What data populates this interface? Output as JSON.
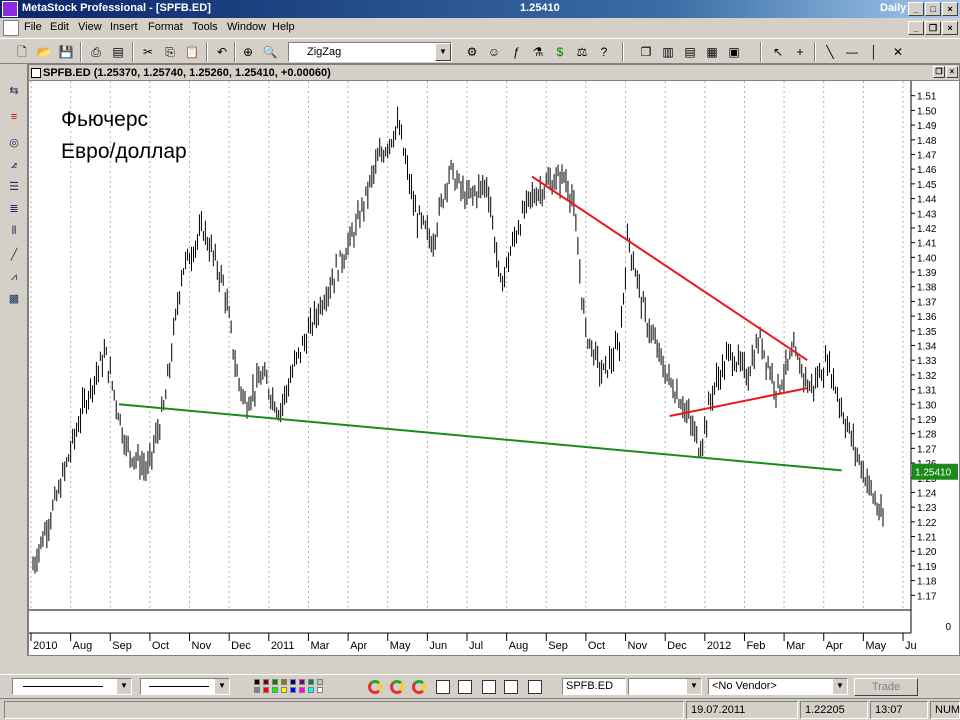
{
  "window": {
    "title": "MetaStock Professional - [SPFB.ED]",
    "price": "1.25410",
    "period": "Daily"
  },
  "menu": [
    "File",
    "Edit",
    "View",
    "Insert",
    "Format",
    "Tools",
    "Window",
    "Help"
  ],
  "toolbar": {
    "indicator_value": "ZigZag"
  },
  "chart_window": {
    "header": "SPFB.ED (1.25370, 1.25740, 1.25260, 1.25410, +0.00060)"
  },
  "annotation": {
    "line1": "Фьючерс",
    "line2": "Евро/доллар"
  },
  "volume_zero_label": "0",
  "colors": {
    "price_bars": "#000000",
    "resistance_line": "#e8191c",
    "support_line": "#1a8a1a",
    "last_price_box": "#1a8a1a"
  },
  "chart_data": {
    "type": "bar",
    "symbol": "SPFB.ED",
    "last_price": "1.25410",
    "ylim": [
      1.16,
      1.52
    ],
    "y_ticks": [
      "1.17",
      "1.18",
      "1.19",
      "1.20",
      "1.21",
      "1.22",
      "1.23",
      "1.24",
      "1.25",
      "1.26",
      "1.27",
      "1.28",
      "1.29",
      "1.30",
      "1.31",
      "1.32",
      "1.33",
      "1.34",
      "1.35",
      "1.36",
      "1.37",
      "1.38",
      "1.39",
      "1.40",
      "1.41",
      "1.42",
      "1.43",
      "1.44",
      "1.45",
      "1.46",
      "1.47",
      "1.48",
      "1.49",
      "1.50",
      "1.51"
    ],
    "x_ticks": [
      "2010",
      "Aug",
      "Sep",
      "Oct",
      "Nov",
      "Dec",
      "2011",
      "Mar",
      "Apr",
      "May",
      "Jun",
      "Jul",
      "Aug",
      "Sep",
      "Oct",
      "Nov",
      "Dec",
      "2012",
      "Feb",
      "Mar",
      "Apr",
      "May",
      "Ju"
    ],
    "price_path": [
      [
        0.0,
        1.19
      ],
      [
        0.03,
        1.24
      ],
      [
        0.06,
        1.3
      ],
      [
        0.085,
        1.335
      ],
      [
        0.11,
        1.27
      ],
      [
        0.135,
        1.255
      ],
      [
        0.155,
        1.3
      ],
      [
        0.175,
        1.39
      ],
      [
        0.2,
        1.42
      ],
      [
        0.225,
        1.38
      ],
      [
        0.24,
        1.32
      ],
      [
        0.25,
        1.3
      ],
      [
        0.27,
        1.32
      ],
      [
        0.29,
        1.295
      ],
      [
        0.31,
        1.33
      ],
      [
        0.34,
        1.37
      ],
      [
        0.38,
        1.42
      ],
      [
        0.405,
        1.465
      ],
      [
        0.43,
        1.49
      ],
      [
        0.45,
        1.43
      ],
      [
        0.47,
        1.41
      ],
      [
        0.49,
        1.46
      ],
      [
        0.51,
        1.44
      ],
      [
        0.535,
        1.45
      ],
      [
        0.55,
        1.38
      ],
      [
        0.57,
        1.42
      ],
      [
        0.585,
        1.44
      ],
      [
        0.605,
        1.45
      ],
      [
        0.625,
        1.455
      ],
      [
        0.635,
        1.44
      ],
      [
        0.65,
        1.35
      ],
      [
        0.67,
        1.32
      ],
      [
        0.69,
        1.34
      ],
      [
        0.7,
        1.415
      ],
      [
        0.72,
        1.36
      ],
      [
        0.745,
        1.32
      ],
      [
        0.765,
        1.3
      ],
      [
        0.785,
        1.27
      ],
      [
        0.8,
        1.31
      ],
      [
        0.82,
        1.335
      ],
      [
        0.84,
        1.32
      ],
      [
        0.855,
        1.345
      ],
      [
        0.875,
        1.31
      ],
      [
        0.895,
        1.335
      ],
      [
        0.915,
        1.31
      ],
      [
        0.935,
        1.33
      ],
      [
        0.955,
        1.29
      ],
      [
        0.97,
        1.265
      ],
      [
        0.98,
        1.25
      ]
    ],
    "trendlines": [
      {
        "name": "resistance",
        "color": "#e8191c",
        "from": [
          "Sep 2011",
          1.455
        ],
        "to": [
          "May 2012",
          1.33
        ]
      },
      {
        "name": "support",
        "color": "#1a8a1a",
        "from": [
          "Sep 2010",
          1.3
        ],
        "to": [
          "Jun 2012",
          1.255
        ]
      },
      {
        "name": "lower-channel",
        "color": "#e8191c",
        "from": [
          "Jan 2012",
          1.292
        ],
        "to": [
          "May 2012",
          1.311
        ]
      }
    ]
  },
  "bottom_toolbar": {
    "symbol_field": "SPFB.ED",
    "vendor_select": "<No Vendor>",
    "trade_label": "Trade"
  },
  "status": {
    "date": "19.07.2011",
    "value": "1.22205",
    "time": "13:07",
    "num": "NUM"
  }
}
